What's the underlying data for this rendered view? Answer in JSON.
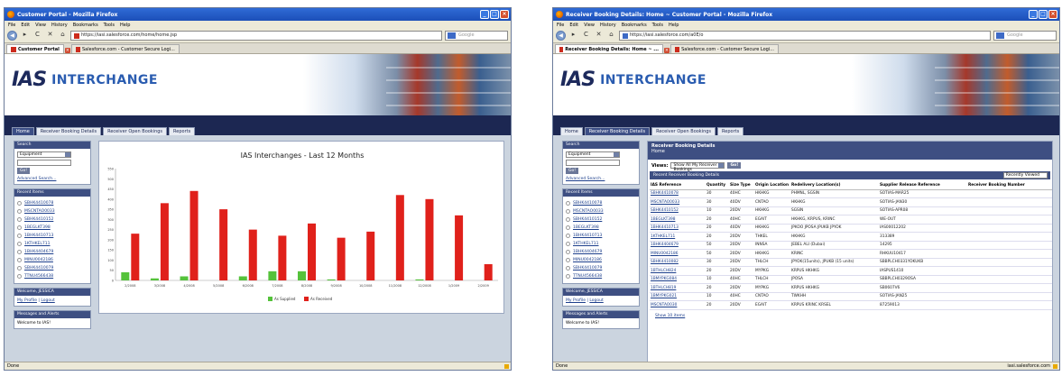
{
  "left_window": {
    "title": "Customer Portal - Mozilla Firefox",
    "menu": [
      "File",
      "Edit",
      "View",
      "History",
      "Bookmarks",
      "Tools",
      "Help"
    ],
    "url": "https://iasi.salesforce.com/home/home.jsp",
    "search_placeholder": "Google",
    "tabs": [
      "Customer Portal",
      "Salesforce.com - Customer Secure Logi..."
    ],
    "status": "Done"
  },
  "right_window": {
    "title": "Receiver Booking Details: Home ~ Customer Portal - Mozilla Firefox",
    "menu": [
      "File",
      "Edit",
      "View",
      "History",
      "Bookmarks",
      "Tools",
      "Help"
    ],
    "url": "https://iasi.salesforce.com/a0E/o",
    "search_placeholder": "Google",
    "tabs": [
      "Receiver Booking Details: Home ~ ...",
      "Salesforce.com - Customer Secure Logi..."
    ],
    "status": "Done",
    "status_right": "iasi.salesforce.com"
  },
  "site": {
    "logo_ias": "IAS",
    "logo_interchange": "INTERCHANGE",
    "nav_tabs": [
      "Home",
      "Receiver Booking Details",
      "Receiver Open Bookings",
      "Reports"
    ]
  },
  "sidebar": {
    "search_label": "Search",
    "search_select": "Equipment",
    "go_label": "Go!",
    "advanced_search": "Advanced Search...",
    "recent_items_label": "Recent Items",
    "recent_items": [
      "SBHK4410078",
      "MSCNTAO0033",
      "SBHK4410152",
      "1BEGLKT398",
      "1BHK4410713",
      "1KTHKEL711",
      "1BHK4404679",
      "MINU0042186",
      "SBHK4410079",
      "TTNU4566438"
    ],
    "welcome_label": "Welcome, JESSICA",
    "my_profile": "My Profile",
    "logout": "Logout",
    "messages_label": "Messages and Alerts",
    "messages_text": "Welcome to IAS!"
  },
  "chart_data": {
    "type": "bar",
    "title": "IAS Interchanges - Last 12 Months",
    "categories": [
      "2/2008",
      "3/2008",
      "4/2008",
      "5/2008",
      "6/2008",
      "7/2008",
      "8/2008",
      "9/2008",
      "10/2008",
      "11/2008",
      "12/2008",
      "1/2009",
      "2/2009"
    ],
    "series": [
      {
        "name": "As Supplied",
        "values": [
          40,
          10,
          20,
          0,
          20,
          45,
          45,
          5,
          0,
          0,
          5,
          0,
          0
        ]
      },
      {
        "name": "As Received",
        "values": [
          230,
          380,
          440,
          350,
          250,
          220,
          280,
          210,
          240,
          420,
          400,
          320,
          80
        ]
      }
    ],
    "ylim": [
      0,
      550
    ],
    "yticks": [
      0,
      50,
      100,
      150,
      200,
      250,
      300,
      350,
      400,
      450,
      500,
      550
    ],
    "colors": {
      "As Supplied": "#55c23b",
      "As Received": "#e0211b"
    },
    "legend_position": "bottom",
    "grid": false
  },
  "booking": {
    "header": "Receiver Booking Details",
    "subheader": "Home",
    "view_label": "Views:",
    "view_select": "Show All My Receiver Bookings",
    "go_label": "Go!",
    "list_label": "Recent Receiver Booking Details",
    "recently_viewed": "Recently Viewed",
    "columns": [
      "IAS Reference",
      "Quantity",
      "Size Type",
      "Origin Location",
      "Redelivery Location(s)",
      "Supplier Release Reference",
      "Receiver Booking Number"
    ],
    "rows": [
      [
        "SBHK4410078",
        "30",
        "40HC",
        "HKHKG",
        "PHMNL, SGSIN",
        "SOTIAS-MAR25",
        ""
      ],
      [
        "MSCNTAO0033",
        "30",
        "40DV",
        "CNTAO",
        "HKHKG",
        "SOTIAS-JAN30",
        ""
      ],
      [
        "SBHK4410152",
        "10",
        "20DV",
        "HKHKG",
        "SGSIN",
        "SOTIAS-APR08",
        ""
      ],
      [
        "1BEGLKT398",
        "20",
        "40HC",
        "EGAIT",
        "HKHKG, KRPUS, KRINC",
        "WE-OUT",
        ""
      ],
      [
        "1BHK4410713",
        "20",
        "40DV",
        "HKHKG",
        "JPKOO JPOSA JPUKB JPYOK",
        "IAS00012202",
        ""
      ],
      [
        "1KTHKEL711",
        "20",
        "20DV",
        "THKEL",
        "HKHKG",
        "313389",
        ""
      ],
      [
        "1BHK4404679",
        "50",
        "20DV",
        "INNSA",
        "JEBEL ALI (Dubai)",
        "14295",
        ""
      ],
      [
        "MINU0042186",
        "50",
        "20DV",
        "HKHKG",
        "KRINC",
        "RHKUU10417",
        ""
      ],
      [
        "SBHK4410082",
        "30",
        "20DV",
        "THLCH",
        "JPYOK(15units), JPUKB (15 units)",
        "SBBPLCH0331YOKUKB",
        ""
      ],
      [
        "1BTHLCH824",
        "20",
        "20DV",
        "MYPKG",
        "KRPUS HKHKG",
        "IASPUS1410",
        ""
      ],
      [
        "1BMYPKG084",
        "10",
        "40HC",
        "THLCH",
        "JPOSA",
        "SBBPLCH0329OSA",
        ""
      ],
      [
        "1BTHLCH819",
        "20",
        "20DV",
        "MYPKG",
        "KRPUS HKHKG",
        "SB0607V6",
        ""
      ],
      [
        "1BMYPKG021",
        "10",
        "40HC",
        "CNTAO",
        "TWKHH",
        "SOTIAS-JAN25",
        ""
      ],
      [
        "MSCNTAO030",
        "20",
        "20DV",
        "EGAIT",
        "KRPUS KRINC KRSEL",
        "87259013",
        ""
      ]
    ],
    "show_more": "Show 10 items"
  }
}
